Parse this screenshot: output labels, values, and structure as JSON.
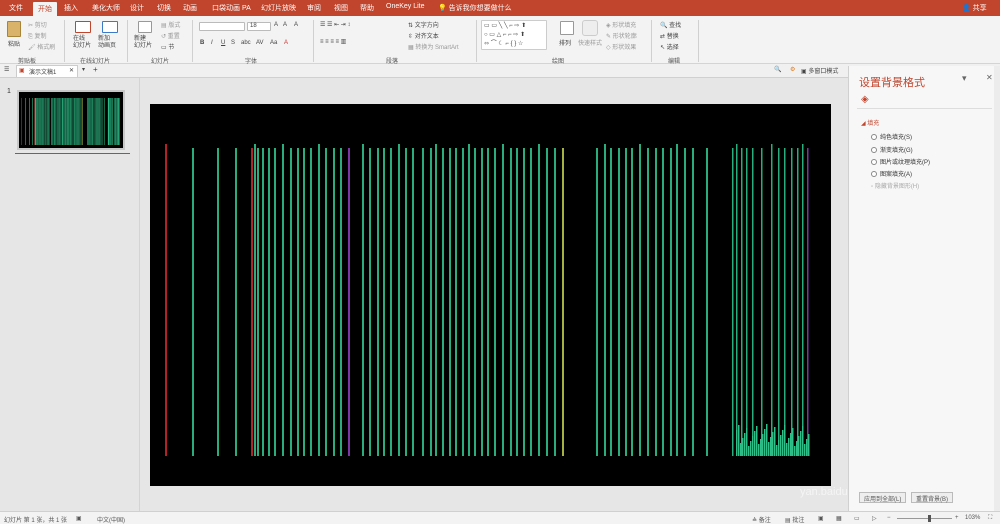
{
  "tabs": [
    "文件",
    "开始",
    "插入",
    "美化大师",
    "设计",
    "切换",
    "动画",
    "口袋动画 PA",
    "幻灯片放映",
    "审阅",
    "视图",
    "帮助",
    "OneKey Lite"
  ],
  "active_tab": "开始",
  "tell_me": "告诉我你想要做什么",
  "share": "共享",
  "ribbon": {
    "paste": "粘贴",
    "cut": "剪切",
    "copy": "复制",
    "format_painter": "格式刷",
    "online_slides": "在线\n幻灯片",
    "new_anim_page": "新加\n动画页",
    "new_slide": "新建\n幻灯片",
    "layout": "版式",
    "reset": "重置",
    "section": "节",
    "font_size": "18",
    "text_direction": "文字方向",
    "align_text": "对齐文本",
    "smartart": "转换为 SmartArt",
    "arrange": "排列",
    "quick_styles": "快速样式",
    "shape_fill": "形状填充",
    "shape_outline": "形状轮廓",
    "shape_effects": "形状效果",
    "find": "查找",
    "replace": "替换",
    "select": "选择"
  },
  "groups": [
    "剪贴板",
    "在线幻灯片",
    "幻灯片",
    "字体",
    "段落",
    "绘图",
    "编辑"
  ],
  "doc_tab": "演示文稿1",
  "multi_window": "多窗口模式",
  "slide_number": "1",
  "pane": {
    "title": "设置背景格式",
    "section": "填充",
    "options": [
      "纯色填充(S)",
      "渐变填充(G)",
      "图片或纹理填充(P)",
      "图案填充(A)"
    ],
    "hide_option": "隐藏背景图形(H)",
    "apply_all": "应用到全部(L)",
    "reset_bg": "重置背景(B)"
  },
  "status": {
    "slide_info": "幻灯片 第 1 张，共 1 张",
    "language": "中文(中国)",
    "notes": "备注",
    "comments": "批注",
    "zoom": "103%"
  },
  "watermark": "yan.baidu.com",
  "colors": {
    "accent": "#c1442c",
    "bar_main": "#2fc08a",
    "bar_red": "#c8262a",
    "bar_purple": "#8a3ab8",
    "bar_yellow": "#b7c44a"
  }
}
